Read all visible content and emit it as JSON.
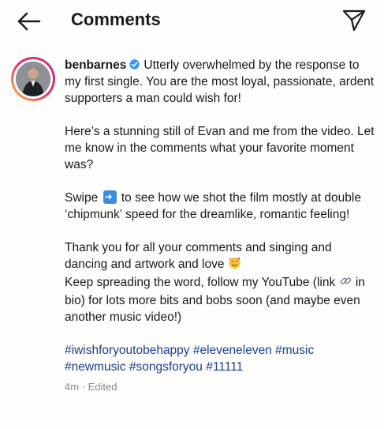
{
  "header": {
    "title": "Comments",
    "back_icon": "back-arrow-icon",
    "send_icon": "send-icon"
  },
  "post": {
    "username": "benbarnes",
    "verified": true,
    "caption_intro": "Utterly overwhelmed by the response to my first single. You are the most loyal, passionate, ardent supporters a man could wish for!",
    "paragraph_2": "Here’s a stunning still of Evan and me from the video. Let me know in the comments what your favorite moment was?",
    "paragraph_3_before": "Swipe",
    "paragraph_3_after": "to see how we shot the film mostly at double ‘chipmunk’ speed for the dreamlike, romantic feeling!",
    "paragraph_4_line1": "Thank you for all your comments and singing and dancing and artwork and love",
    "paragraph_4_line2_before": "Keep spreading the word,  follow my YouTube (link",
    "paragraph_4_line2_after": "in bio) for lots more bits and bobs soon (and maybe even another music video!)",
    "hashtags_line1": "#iwishforyoutobehappy #eleveneleven #music",
    "hashtags_line2": "#newmusic #songsforyou #11111",
    "timestamp": "4m · Edited",
    "colors": {
      "hashtag": "#1d3f8f",
      "verified": "#3897f0",
      "meta": "#8a8a8a"
    }
  }
}
